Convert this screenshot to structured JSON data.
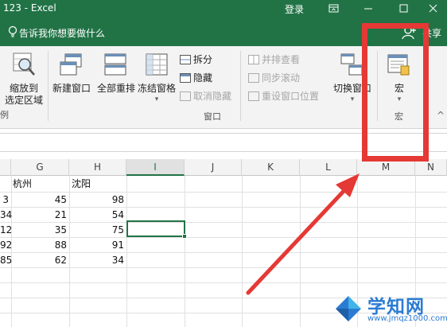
{
  "window": {
    "title": "123 - Excel",
    "login": "登录"
  },
  "tell_me": {
    "text": "告诉我你想要做什么",
    "share": "共享"
  },
  "ribbon": {
    "zoom_selection": {
      "line1": "缩放到",
      "line2": "选定区域"
    },
    "new_window": "新建窗口",
    "arrange_all": "全部重排",
    "freeze_panes": "冻结窗格",
    "split": "拆分",
    "hide": "隐藏",
    "unhide": "取消隐藏",
    "view_side_by_side": "并排查看",
    "sync_scroll": "同步滚动",
    "reset_position": "重设窗口位置",
    "switch_windows": "切换窗口",
    "macros": "宏",
    "group_window": "窗口",
    "group_macros": "宏",
    "group_zoom_partial": "例"
  },
  "columns": [
    "G",
    "H",
    "I",
    "J",
    "K",
    "L",
    "M",
    "N"
  ],
  "selected_column": "I",
  "rows": [
    {
      "f": "",
      "g": "杭州",
      "h": "沈阳"
    },
    {
      "f": "3",
      "g": "45",
      "h": "98"
    },
    {
      "f": "34",
      "g": "21",
      "h": "54"
    },
    {
      "f": "12",
      "g": "35",
      "h": "75"
    },
    {
      "f": "92",
      "g": "88",
      "h": "91"
    },
    {
      "f": "85",
      "g": "62",
      "h": "34"
    }
  ],
  "watermark": {
    "text": "学知网",
    "url": "www.jmqz1000.com"
  },
  "colors": {
    "excel_green": "#217346",
    "annotation_red": "#e53935",
    "watermark_blue": "#2b7bd2"
  }
}
